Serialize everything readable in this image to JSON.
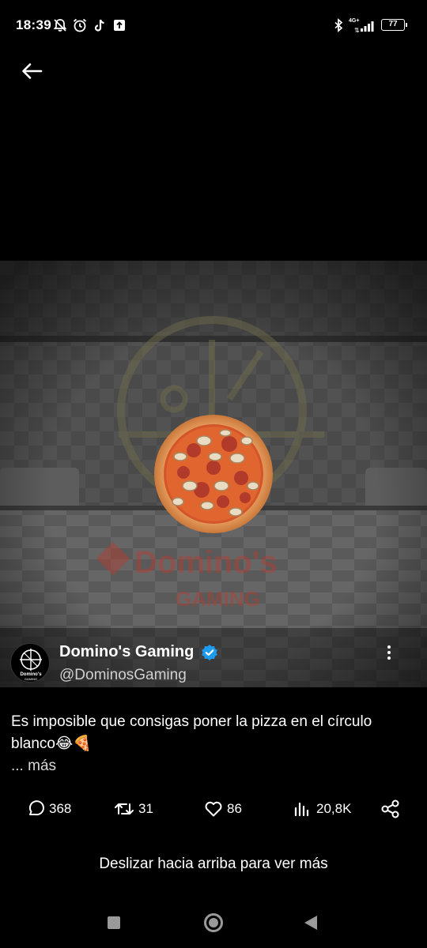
{
  "status_bar": {
    "time": "18:39",
    "network": "4G+",
    "battery": "77",
    "icons": [
      "muted-bell-icon",
      "alarm-icon",
      "tiktok-icon",
      "upload-icon",
      "bluetooth-icon",
      "signal-icon",
      "battery-icon"
    ]
  },
  "header": {
    "back_icon": "arrow-left-icon"
  },
  "media": {
    "watermark_brand": "Domino's",
    "watermark_sub": "GAMING"
  },
  "author": {
    "display_name": "Domino's Gaming",
    "handle": "@DominosGaming",
    "avatar_brand": "Domino's",
    "avatar_sub": "GAMING",
    "verified": true
  },
  "post": {
    "caption": "Es imposible que consigas poner la pizza en el círculo blanco😂🍕",
    "more_label": "... más"
  },
  "actions": {
    "replies": "368",
    "reposts": "31",
    "likes": "86",
    "views": "20,8K"
  },
  "footer": {
    "swipe_hint": "Deslizar hacia arriba para ver más"
  },
  "colors": {
    "background": "#000000",
    "verified": "#1d9bf0",
    "watermark_red": "#c0392b"
  }
}
